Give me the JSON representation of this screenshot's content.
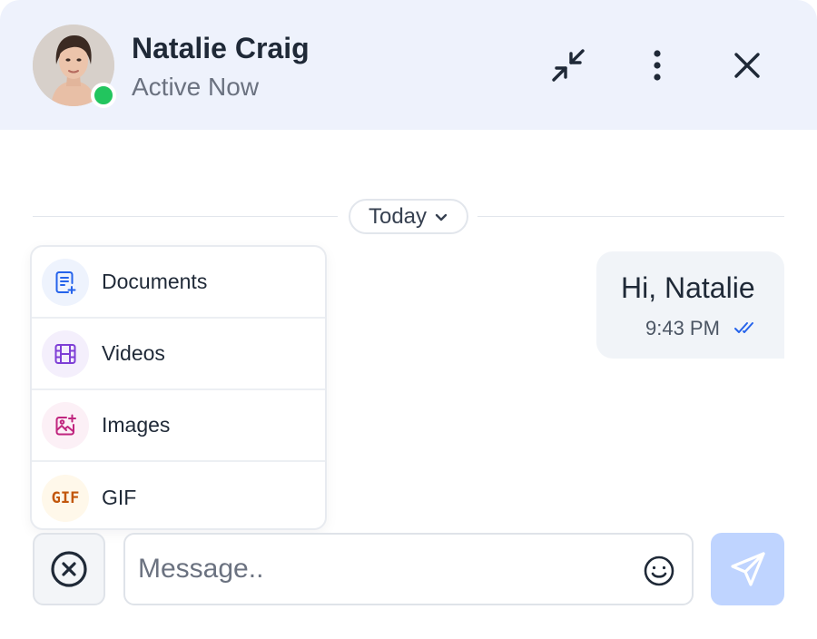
{
  "header": {
    "contact_name": "Natalie Craig",
    "contact_status": "Active Now",
    "avatar_icon": "person-portrait",
    "status_color": "#22c55e",
    "background": "#eef2fc",
    "actions": [
      "minimize-icon",
      "more-vertical-icon",
      "close-icon"
    ]
  },
  "conversation": {
    "date_label": "Today",
    "messages": [
      {
        "text": "Hi, Natalie",
        "time": "9:43 PM",
        "status_icon": "double-check-icon",
        "status_color": "#2563eb"
      }
    ]
  },
  "attachment_menu": {
    "items": [
      {
        "label": "Documents",
        "icon": "document-add-icon",
        "icon_color": "#2563eb",
        "icon_bg": "#eef3fd"
      },
      {
        "label": "Videos",
        "icon": "film-icon",
        "icon_color": "#7e3fd6",
        "icon_bg": "#f4effc"
      },
      {
        "label": "Images",
        "icon": "image-add-icon",
        "icon_color": "#c0267f",
        "icon_bg": "#fcf0f6"
      },
      {
        "label": "GIF",
        "icon": "gif-icon",
        "glyph": "GIF",
        "icon_color": "#c2570c",
        "icon_bg": "#fff8ea"
      }
    ]
  },
  "composer": {
    "placeholder": "Message..",
    "value": "",
    "cancel_icon": "circle-x-icon",
    "emoji_icon": "smile-icon",
    "send_icon": "paper-plane-icon",
    "send_bg": "#bfd4ff"
  }
}
